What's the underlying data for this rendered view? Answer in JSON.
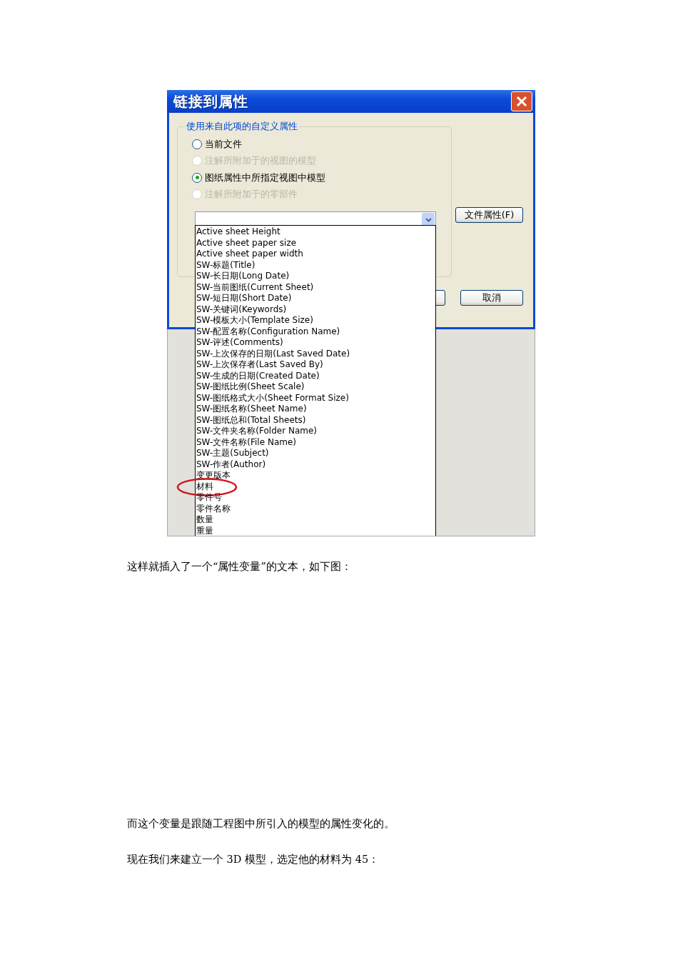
{
  "dialog": {
    "title": "链接到属性",
    "group_label": "使用来自此项的自定义属性",
    "sources": [
      {
        "label": "当前文件",
        "selected": false,
        "disabled": false
      },
      {
        "label": "注解所附加于的视图的模型",
        "selected": false,
        "disabled": true
      },
      {
        "label": "图纸属性中所指定视图中模型",
        "selected": true,
        "disabled": false
      },
      {
        "label": "注解所附加于的零部件",
        "selected": false,
        "disabled": true
      }
    ],
    "file_properties_button": "文件属性(F)",
    "cancel_button": "取消",
    "dropdown_items": [
      {
        "label": "Active sheet Height",
        "circled": false
      },
      {
        "label": "Active sheet paper size",
        "circled": false
      },
      {
        "label": "Active sheet paper width",
        "circled": false
      },
      {
        "label": "SW-标题(Title)",
        "circled": false
      },
      {
        "label": "SW-长日期(Long Date)",
        "circled": false
      },
      {
        "label": "SW-当前图纸(Current Sheet)",
        "circled": false
      },
      {
        "label": "SW-短日期(Short Date)",
        "circled": false
      },
      {
        "label": "SW-关键词(Keywords)",
        "circled": false
      },
      {
        "label": "SW-模板大小(Template Size)",
        "circled": false
      },
      {
        "label": "SW-配置名称(Configuration Name)",
        "circled": false
      },
      {
        "label": "SW-评述(Comments)",
        "circled": false
      },
      {
        "label": "SW-上次保存的日期(Last Saved Date)",
        "circled": false
      },
      {
        "label": "SW-上次保存者(Last Saved By)",
        "circled": false
      },
      {
        "label": "SW-生成的日期(Created Date)",
        "circled": false
      },
      {
        "label": "SW-图纸比例(Sheet Scale)",
        "circled": false
      },
      {
        "label": "SW-图纸格式大小(Sheet Format Size)",
        "circled": false
      },
      {
        "label": "SW-图纸名称(Sheet Name)",
        "circled": false
      },
      {
        "label": "SW-图纸总和(Total Sheets)",
        "circled": false
      },
      {
        "label": "SW-文件夹名称(Folder Name)",
        "circled": false
      },
      {
        "label": "SW-文件名称(File Name)",
        "circled": false
      },
      {
        "label": "SW-主题(Subject)",
        "circled": false
      },
      {
        "label": "SW-作者(Author)",
        "circled": false
      },
      {
        "label": "变更版本",
        "circled": false
      },
      {
        "label": "材料",
        "circled": true
      },
      {
        "label": "零件号",
        "circled": false
      },
      {
        "label": "零件名称",
        "circled": false
      },
      {
        "label": "数量",
        "circled": false
      },
      {
        "label": "重量",
        "circled": false
      }
    ]
  },
  "paragraphs": [
    "这样就插入了一个“属性变量”的文本，如下图：",
    "而这个变量是跟随工程图中所引入的模型的属性变化的。",
    "现在我们来建立一个 3D 模型，选定他的材料为 45："
  ]
}
